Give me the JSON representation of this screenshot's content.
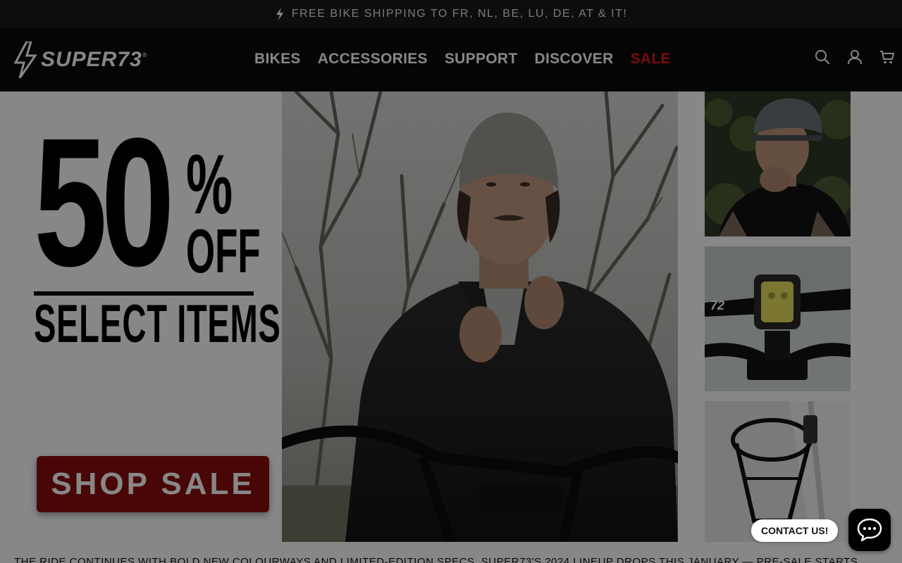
{
  "announcement": {
    "text": "FREE BIKE SHIPPING TO FR, NL, BE, LU, DE, AT & IT!",
    "icon": "lightning-bolt-icon"
  },
  "header": {
    "logo_text": "SUPER73",
    "logo_reg": "®",
    "nav": [
      {
        "label": "BIKES"
      },
      {
        "label": "ACCESSORIES"
      },
      {
        "label": "SUPPORT"
      },
      {
        "label": "DISCOVER"
      },
      {
        "label": "SALE"
      }
    ],
    "icons": [
      "search-icon",
      "account-icon",
      "cart-icon"
    ]
  },
  "hero": {
    "promo_number": "50",
    "promo_percent": "%",
    "promo_off": "OFF",
    "promo_sub": "SELECT ITEMS",
    "cta_label": "SHOP SALE"
  },
  "footer_strip": {
    "text": "THE RIDE CONTINUES WITH BOLD NEW COLOURWAYS AND LIMITED-EDITION SPECS. SUPER73'S 2024 LINEUP DROPS THIS JANUARY — PRE-SALE STARTS"
  },
  "chat": {
    "label": "CONTACT US!",
    "icon": "chat-bubble-icon"
  },
  "colors": {
    "accent_sale": "#e01a1a",
    "cta_bg": "#8a0d0d",
    "header_bg": "#0b0b0b",
    "overlay": "rgba(0,0,0,0.47)"
  }
}
